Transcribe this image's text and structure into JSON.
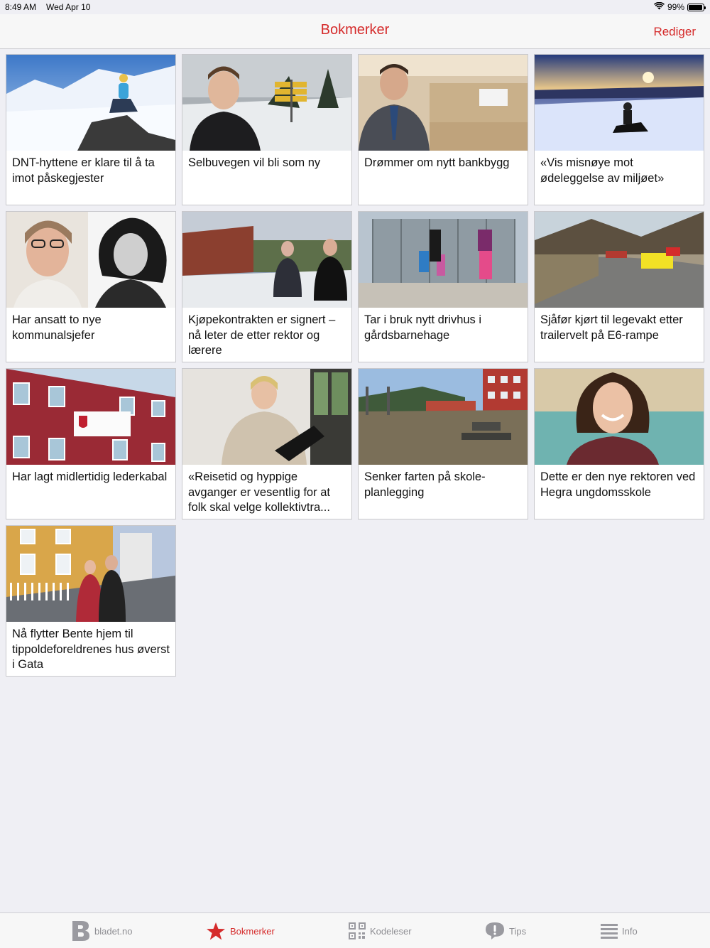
{
  "status": {
    "time": "8:49 AM",
    "date": "Wed Apr 10",
    "battery": "99%"
  },
  "nav": {
    "title": "Bokmerker",
    "edit_label": "Rediger"
  },
  "articles": [
    {
      "title": "DNT-hyttene er klare til å ta imot påskegjester",
      "image": "mountain-snow-hiker"
    },
    {
      "title": "Selbuvegen vil bli som ny",
      "image": "man-by-road-signs"
    },
    {
      "title": "Drømmer om nytt bankbygg",
      "image": "man-in-bank-office"
    },
    {
      "title": "«Vis misnøye mot ødeleggelse av miljøet»",
      "image": "snowmobile-sunset"
    },
    {
      "title": "Har ansatt to nye kommunalsjefer",
      "image": "two-portraits"
    },
    {
      "title": "Kjøpekontrakten er signert – nå leter de etter rektor og lærere",
      "image": "two-men-outside-building"
    },
    {
      "title": "Tar i bruk nytt drivhus i gårdsbarnehage",
      "image": "family-at-greenhouse"
    },
    {
      "title": "Sjåfør kjørt til legevakt etter trailervelt på E6-rampe",
      "image": "fire-truck-on-road"
    },
    {
      "title": "Har lagt midlertidig lederkabal",
      "image": "town-hall-facade"
    },
    {
      "title": "«Reisetid og hyppige avganger er vesentlig for at folk skal velge kollektivtra...",
      "image": "woman-with-laptop"
    },
    {
      "title": "Senker farten på skole-planlegging",
      "image": "schoolyard"
    },
    {
      "title": "Dette er den nye rektoren ved Hegra ungdomsskole",
      "image": "smiling-woman-portrait"
    },
    {
      "title": "Nå flytter Bente hjem til tippoldeforeldrenes hus øverst i Gata",
      "image": "couple-in-street"
    }
  ],
  "tabs": [
    {
      "label": "bladet.no",
      "icon": "b-logo-icon"
    },
    {
      "label": "Bokmerker",
      "icon": "star-icon",
      "active": true
    },
    {
      "label": "Kodeleser",
      "icon": "qr-code-icon"
    },
    {
      "label": "Tips",
      "icon": "exclamation-bubble-icon"
    },
    {
      "label": "Info",
      "icon": "list-icon"
    }
  ],
  "colors": {
    "accent": "#d52b2b",
    "background": "#efeff4",
    "tab_inactive": "#8e8e93"
  }
}
